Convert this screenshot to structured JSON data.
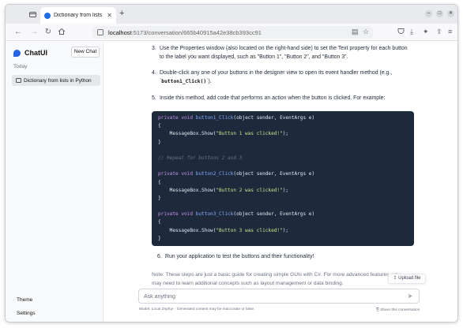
{
  "browser": {
    "tab_title": "Dictionary from lists in",
    "url_host": "localhost",
    "url_path": ":5173/conversation/665b40915a42e38cb393cc91",
    "new_tab_symbol": "+",
    "win_min": "–",
    "win_max": "□",
    "win_close": "✕"
  },
  "sidebar": {
    "brand": "ChatUI",
    "new_chat": "New Chat",
    "section_label": "Today",
    "conversations": [
      {
        "label": "Dictionary from lists in Python"
      }
    ],
    "footer": {
      "theme": "Theme",
      "settings": "Settings"
    }
  },
  "main": {
    "steps": [
      {
        "num": "3.",
        "line1": "Use the Properties window (also located on the right-hand side) to set the Text property for each button",
        "line2": "to the label you want displayed, such as \"Button 1\", \"Button 2\", and \"Button 3\"."
      },
      {
        "num": "4.",
        "line1": "Double-click any one of your buttons in the designer view to open its event handler method (e.g.,",
        "line2_pre": "`",
        "line2_code": "button1_Click()",
        "line2_post": "`)."
      },
      {
        "num": "5.",
        "line1": "Inside this method, add code that performs an action when the button is clicked. For example:"
      },
      {
        "num": "6.",
        "line1": "Run your application to test the buttons and their functionality!"
      }
    ],
    "code_lines": [
      {
        "type": "sig",
        "pre": "private void ",
        "fn": "button1_Click",
        "args": "(object sender, EventArgs e)"
      },
      {
        "type": "plain",
        "text": "{"
      },
      {
        "type": "call",
        "pre": "    MessageBox.Show(",
        "str": "\"Button 1 was clicked!\"",
        "post": ");"
      },
      {
        "type": "plain",
        "text": "}"
      },
      {
        "type": "plain",
        "text": ""
      },
      {
        "type": "comment",
        "text": "// Repeat for buttons 2 and 3"
      },
      {
        "type": "plain",
        "text": ""
      },
      {
        "type": "sig",
        "pre": "private void ",
        "fn": "button2_Click",
        "args": "(object sender, EventArgs e)"
      },
      {
        "type": "plain",
        "text": "{"
      },
      {
        "type": "call",
        "pre": "    MessageBox.Show(",
        "str": "\"Button 2 was clicked!\"",
        "post": ");"
      },
      {
        "type": "plain",
        "text": "}"
      },
      {
        "type": "plain",
        "text": ""
      },
      {
        "type": "sig",
        "pre": "private void ",
        "fn": "button3_Click",
        "args": "(object sender, EventArgs e)"
      },
      {
        "type": "plain",
        "text": "{"
      },
      {
        "type": "call",
        "pre": "    MessageBox.Show(",
        "str": "\"Button 3 was clicked!\"",
        "post": ");"
      },
      {
        "type": "plain",
        "text": "}"
      }
    ],
    "note_line1": "Note: These steps are just a basic guide for creating simple GUIs with C#. For more advanced features, you",
    "note_line2": "may need to learn additional concepts such as layout management or data binding.",
    "upload_label": "Upload file",
    "input_placeholder": "Ask anything",
    "footer_model": "Model: Local Zephyr · Generated content may be inaccurate or false.",
    "footer_share": "Share this conversation"
  }
}
